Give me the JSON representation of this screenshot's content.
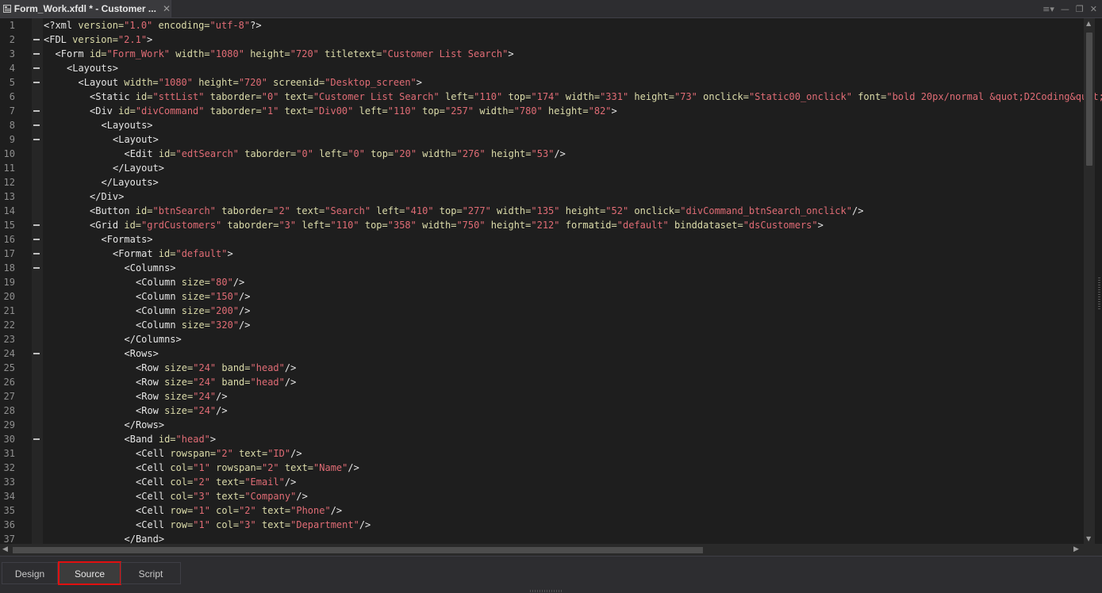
{
  "document_tab": {
    "title": "Form_Work.xfdl * - Customer ...",
    "close_glyph": "✕"
  },
  "window_controls": {
    "menu_glyph": "≡▾",
    "minimize_glyph": "—",
    "restore_glyph": "❐",
    "close_glyph": "✕"
  },
  "editor": {
    "lines": [
      {
        "n": "1",
        "fold": false,
        "indent": 0,
        "tokens": [
          [
            "pi",
            "<?xml "
          ],
          [
            "attr",
            "version="
          ],
          [
            "str",
            "\"1.0\""
          ],
          [
            "attr",
            " encoding="
          ],
          [
            "str",
            "\"utf-8\""
          ],
          [
            "pi",
            "?>"
          ]
        ]
      },
      {
        "n": "2",
        "fold": true,
        "indent": 0,
        "tokens": [
          [
            "tag",
            "<FDL "
          ],
          [
            "attr",
            "version="
          ],
          [
            "str",
            "\"2.1\""
          ],
          [
            "tag",
            ">"
          ]
        ]
      },
      {
        "n": "3",
        "fold": true,
        "indent": 1,
        "tokens": [
          [
            "tag",
            "<Form "
          ],
          [
            "attr",
            "id="
          ],
          [
            "str",
            "\"Form_Work\""
          ],
          [
            "attr",
            " width="
          ],
          [
            "str",
            "\"1080\""
          ],
          [
            "attr",
            " height="
          ],
          [
            "str",
            "\"720\""
          ],
          [
            "attr",
            " titletext="
          ],
          [
            "str",
            "\"Customer List Search\""
          ],
          [
            "tag",
            ">"
          ]
        ]
      },
      {
        "n": "4",
        "fold": true,
        "indent": 2,
        "tokens": [
          [
            "tag",
            "<Layouts>"
          ]
        ]
      },
      {
        "n": "5",
        "fold": true,
        "indent": 3,
        "tokens": [
          [
            "tag",
            "<Layout "
          ],
          [
            "attr",
            "width="
          ],
          [
            "str",
            "\"1080\""
          ],
          [
            "attr",
            " height="
          ],
          [
            "str",
            "\"720\""
          ],
          [
            "attr",
            " screenid="
          ],
          [
            "str",
            "\"Desktop_screen\""
          ],
          [
            "tag",
            ">"
          ]
        ]
      },
      {
        "n": "6",
        "fold": false,
        "indent": 4,
        "tokens": [
          [
            "tag",
            "<Static "
          ],
          [
            "attr",
            "id="
          ],
          [
            "str",
            "\"sttList\""
          ],
          [
            "attr",
            " taborder="
          ],
          [
            "str",
            "\"0\""
          ],
          [
            "attr",
            " text="
          ],
          [
            "str",
            "\"Customer List Search\""
          ],
          [
            "attr",
            " left="
          ],
          [
            "str",
            "\"110\""
          ],
          [
            "attr",
            " top="
          ],
          [
            "str",
            "\"174\""
          ],
          [
            "attr",
            " width="
          ],
          [
            "str",
            "\"331\""
          ],
          [
            "attr",
            " height="
          ],
          [
            "str",
            "\"73\""
          ],
          [
            "attr",
            " onclick="
          ],
          [
            "str",
            "\"Static00_onclick\""
          ],
          [
            "attr",
            " font="
          ],
          [
            "str",
            "\"bold 20px/normal &quot;D2Coding&quot;\""
          ],
          [
            "tag",
            "/"
          ]
        ]
      },
      {
        "n": "7",
        "fold": true,
        "indent": 4,
        "tokens": [
          [
            "tag",
            "<Div "
          ],
          [
            "attr",
            "id="
          ],
          [
            "str",
            "\"divCommand\""
          ],
          [
            "attr",
            " taborder="
          ],
          [
            "str",
            "\"1\""
          ],
          [
            "attr",
            " text="
          ],
          [
            "str",
            "\"Div00\""
          ],
          [
            "attr",
            " left="
          ],
          [
            "str",
            "\"110\""
          ],
          [
            "attr",
            " top="
          ],
          [
            "str",
            "\"257\""
          ],
          [
            "attr",
            " width="
          ],
          [
            "str",
            "\"780\""
          ],
          [
            "attr",
            " height="
          ],
          [
            "str",
            "\"82\""
          ],
          [
            "tag",
            ">"
          ]
        ]
      },
      {
        "n": "8",
        "fold": true,
        "indent": 5,
        "tokens": [
          [
            "tag",
            "<Layouts>"
          ]
        ]
      },
      {
        "n": "9",
        "fold": true,
        "indent": 6,
        "tokens": [
          [
            "tag",
            "<Layout>"
          ]
        ]
      },
      {
        "n": "10",
        "fold": false,
        "indent": 7,
        "tokens": [
          [
            "tag",
            "<Edit "
          ],
          [
            "attr",
            "id="
          ],
          [
            "str",
            "\"edtSearch\""
          ],
          [
            "attr",
            " taborder="
          ],
          [
            "str",
            "\"0\""
          ],
          [
            "attr",
            " left="
          ],
          [
            "str",
            "\"0\""
          ],
          [
            "attr",
            " top="
          ],
          [
            "str",
            "\"20\""
          ],
          [
            "attr",
            " width="
          ],
          [
            "str",
            "\"276\""
          ],
          [
            "attr",
            " height="
          ],
          [
            "str",
            "\"53\""
          ],
          [
            "tag",
            "/>"
          ]
        ]
      },
      {
        "n": "11",
        "fold": false,
        "indent": 6,
        "tokens": [
          [
            "tag",
            "</Layout>"
          ]
        ]
      },
      {
        "n": "12",
        "fold": false,
        "indent": 5,
        "tokens": [
          [
            "tag",
            "</Layouts>"
          ]
        ]
      },
      {
        "n": "13",
        "fold": false,
        "indent": 4,
        "tokens": [
          [
            "tag",
            "</Div>"
          ]
        ]
      },
      {
        "n": "14",
        "fold": false,
        "indent": 4,
        "tokens": [
          [
            "tag",
            "<Button "
          ],
          [
            "attr",
            "id="
          ],
          [
            "str",
            "\"btnSearch\""
          ],
          [
            "attr",
            " taborder="
          ],
          [
            "str",
            "\"2\""
          ],
          [
            "attr",
            " text="
          ],
          [
            "str",
            "\"Search\""
          ],
          [
            "attr",
            " left="
          ],
          [
            "str",
            "\"410\""
          ],
          [
            "attr",
            " top="
          ],
          [
            "str",
            "\"277\""
          ],
          [
            "attr",
            " width="
          ],
          [
            "str",
            "\"135\""
          ],
          [
            "attr",
            " height="
          ],
          [
            "str",
            "\"52\""
          ],
          [
            "attr",
            " onclick="
          ],
          [
            "str",
            "\"divCommand_btnSearch_onclick\""
          ],
          [
            "tag",
            "/>"
          ]
        ]
      },
      {
        "n": "15",
        "fold": true,
        "indent": 4,
        "tokens": [
          [
            "tag",
            "<Grid "
          ],
          [
            "attr",
            "id="
          ],
          [
            "str",
            "\"grdCustomers\""
          ],
          [
            "attr",
            " taborder="
          ],
          [
            "str",
            "\"3\""
          ],
          [
            "attr",
            " left="
          ],
          [
            "str",
            "\"110\""
          ],
          [
            "attr",
            " top="
          ],
          [
            "str",
            "\"358\""
          ],
          [
            "attr",
            " width="
          ],
          [
            "str",
            "\"750\""
          ],
          [
            "attr",
            " height="
          ],
          [
            "str",
            "\"212\""
          ],
          [
            "attr",
            " formatid="
          ],
          [
            "str",
            "\"default\""
          ],
          [
            "attr",
            " binddataset="
          ],
          [
            "str",
            "\"dsCustomers\""
          ],
          [
            "tag",
            ">"
          ]
        ]
      },
      {
        "n": "16",
        "fold": true,
        "indent": 5,
        "tokens": [
          [
            "tag",
            "<Formats>"
          ]
        ]
      },
      {
        "n": "17",
        "fold": true,
        "indent": 6,
        "tokens": [
          [
            "tag",
            "<Format "
          ],
          [
            "attr",
            "id="
          ],
          [
            "str",
            "\"default\""
          ],
          [
            "tag",
            ">"
          ]
        ]
      },
      {
        "n": "18",
        "fold": true,
        "indent": 7,
        "tokens": [
          [
            "tag",
            "<Columns>"
          ]
        ]
      },
      {
        "n": "19",
        "fold": false,
        "indent": 8,
        "tokens": [
          [
            "tag",
            "<Column "
          ],
          [
            "attr",
            "size="
          ],
          [
            "str",
            "\"80\""
          ],
          [
            "tag",
            "/>"
          ]
        ]
      },
      {
        "n": "20",
        "fold": false,
        "indent": 8,
        "tokens": [
          [
            "tag",
            "<Column "
          ],
          [
            "attr",
            "size="
          ],
          [
            "str",
            "\"150\""
          ],
          [
            "tag",
            "/>"
          ]
        ]
      },
      {
        "n": "21",
        "fold": false,
        "indent": 8,
        "tokens": [
          [
            "tag",
            "<Column "
          ],
          [
            "attr",
            "size="
          ],
          [
            "str",
            "\"200\""
          ],
          [
            "tag",
            "/>"
          ]
        ]
      },
      {
        "n": "22",
        "fold": false,
        "indent": 8,
        "tokens": [
          [
            "tag",
            "<Column "
          ],
          [
            "attr",
            "size="
          ],
          [
            "str",
            "\"320\""
          ],
          [
            "tag",
            "/>"
          ]
        ]
      },
      {
        "n": "23",
        "fold": false,
        "indent": 7,
        "tokens": [
          [
            "tag",
            "</Columns>"
          ]
        ]
      },
      {
        "n": "24",
        "fold": true,
        "indent": 7,
        "tokens": [
          [
            "tag",
            "<Rows>"
          ]
        ]
      },
      {
        "n": "25",
        "fold": false,
        "indent": 8,
        "tokens": [
          [
            "tag",
            "<Row "
          ],
          [
            "attr",
            "size="
          ],
          [
            "str",
            "\"24\""
          ],
          [
            "attr",
            " band="
          ],
          [
            "str",
            "\"head\""
          ],
          [
            "tag",
            "/>"
          ]
        ]
      },
      {
        "n": "26",
        "fold": false,
        "indent": 8,
        "tokens": [
          [
            "tag",
            "<Row "
          ],
          [
            "attr",
            "size="
          ],
          [
            "str",
            "\"24\""
          ],
          [
            "attr",
            " band="
          ],
          [
            "str",
            "\"head\""
          ],
          [
            "tag",
            "/>"
          ]
        ]
      },
      {
        "n": "27",
        "fold": false,
        "indent": 8,
        "tokens": [
          [
            "tag",
            "<Row "
          ],
          [
            "attr",
            "size="
          ],
          [
            "str",
            "\"24\""
          ],
          [
            "tag",
            "/>"
          ]
        ]
      },
      {
        "n": "28",
        "fold": false,
        "indent": 8,
        "tokens": [
          [
            "tag",
            "<Row "
          ],
          [
            "attr",
            "size="
          ],
          [
            "str",
            "\"24\""
          ],
          [
            "tag",
            "/>"
          ]
        ]
      },
      {
        "n": "29",
        "fold": false,
        "indent": 7,
        "tokens": [
          [
            "tag",
            "</Rows>"
          ]
        ]
      },
      {
        "n": "30",
        "fold": true,
        "indent": 7,
        "tokens": [
          [
            "tag",
            "<Band "
          ],
          [
            "attr",
            "id="
          ],
          [
            "str",
            "\"head\""
          ],
          [
            "tag",
            ">"
          ]
        ]
      },
      {
        "n": "31",
        "fold": false,
        "indent": 8,
        "tokens": [
          [
            "tag",
            "<Cell "
          ],
          [
            "attr",
            "rowspan="
          ],
          [
            "str",
            "\"2\""
          ],
          [
            "attr",
            " text="
          ],
          [
            "str",
            "\"ID\""
          ],
          [
            "tag",
            "/>"
          ]
        ]
      },
      {
        "n": "32",
        "fold": false,
        "indent": 8,
        "tokens": [
          [
            "tag",
            "<Cell "
          ],
          [
            "attr",
            "col="
          ],
          [
            "str",
            "\"1\""
          ],
          [
            "attr",
            " rowspan="
          ],
          [
            "str",
            "\"2\""
          ],
          [
            "attr",
            " text="
          ],
          [
            "str",
            "\"Name\""
          ],
          [
            "tag",
            "/>"
          ]
        ]
      },
      {
        "n": "33",
        "fold": false,
        "indent": 8,
        "tokens": [
          [
            "tag",
            "<Cell "
          ],
          [
            "attr",
            "col="
          ],
          [
            "str",
            "\"2\""
          ],
          [
            "attr",
            " text="
          ],
          [
            "str",
            "\"Email\""
          ],
          [
            "tag",
            "/>"
          ]
        ]
      },
      {
        "n": "34",
        "fold": false,
        "indent": 8,
        "tokens": [
          [
            "tag",
            "<Cell "
          ],
          [
            "attr",
            "col="
          ],
          [
            "str",
            "\"3\""
          ],
          [
            "attr",
            " text="
          ],
          [
            "str",
            "\"Company\""
          ],
          [
            "tag",
            "/>"
          ]
        ]
      },
      {
        "n": "35",
        "fold": false,
        "indent": 8,
        "tokens": [
          [
            "tag",
            "<Cell "
          ],
          [
            "attr",
            "row="
          ],
          [
            "str",
            "\"1\""
          ],
          [
            "attr",
            " col="
          ],
          [
            "str",
            "\"2\""
          ],
          [
            "attr",
            " text="
          ],
          [
            "str",
            "\"Phone\""
          ],
          [
            "tag",
            "/>"
          ]
        ]
      },
      {
        "n": "36",
        "fold": false,
        "indent": 8,
        "tokens": [
          [
            "tag",
            "<Cell "
          ],
          [
            "attr",
            "row="
          ],
          [
            "str",
            "\"1\""
          ],
          [
            "attr",
            " col="
          ],
          [
            "str",
            "\"3\""
          ],
          [
            "attr",
            " text="
          ],
          [
            "str",
            "\"Department\""
          ],
          [
            "tag",
            "/>"
          ]
        ]
      },
      {
        "n": "37",
        "fold": false,
        "indent": 7,
        "tokens": [
          [
            "tag",
            "</Band>"
          ]
        ]
      }
    ]
  },
  "scrollbars": {
    "up_glyph": "▲",
    "down_glyph": "▼",
    "left_glyph": "◀",
    "right_glyph": "▶"
  },
  "bottom_tabs": [
    {
      "label": "Design",
      "active": false
    },
    {
      "label": "Source",
      "active": true
    },
    {
      "label": "Script",
      "active": false
    }
  ],
  "colors": {
    "background": "#1e1e1e",
    "tag": "#e6e6e6",
    "attribute": "#dcdcaa",
    "string": "#e06c75",
    "highlight_outline": "#e01010"
  }
}
